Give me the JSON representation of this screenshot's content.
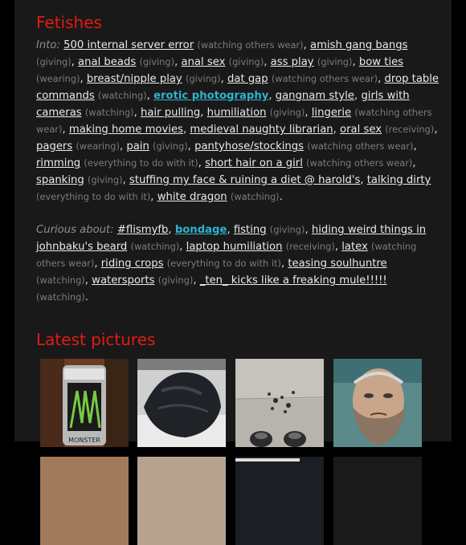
{
  "sections": {
    "fetishes_title": "Fetishes",
    "pictures_title": "Latest pictures"
  },
  "into": {
    "label": "Into:",
    "items": [
      {
        "name": "500 internal server error",
        "role": "(watching others wear)"
      },
      {
        "name": "amish gang bangs",
        "role": "(giving)"
      },
      {
        "name": "anal beads",
        "role": "(giving)"
      },
      {
        "name": "anal sex",
        "role": "(giving)"
      },
      {
        "name": "ass play",
        "role": "(giving)"
      },
      {
        "name": "bow ties",
        "role": "(wearing)"
      },
      {
        "name": "breast/nipple play",
        "role": "(giving)"
      },
      {
        "name": "dat gap",
        "role": "(watching others wear)"
      },
      {
        "name": "drop table commands",
        "role": "(watching)"
      },
      {
        "name": "erotic photography",
        "role": "",
        "highlight": true
      },
      {
        "name": "gangnam style",
        "role": ""
      },
      {
        "name": "girls with cameras",
        "role": "(watching)"
      },
      {
        "name": "hair pulling",
        "role": ""
      },
      {
        "name": "humiliation",
        "role": "(giving)"
      },
      {
        "name": "lingerie",
        "role": "(watching others wear)"
      },
      {
        "name": "making home movies",
        "role": ""
      },
      {
        "name": "medieval naughty librarian",
        "role": ""
      },
      {
        "name": "oral sex",
        "role": "(receiving)"
      },
      {
        "name": "pagers",
        "role": "(wearing)"
      },
      {
        "name": "pain",
        "role": "(giving)"
      },
      {
        "name": "pantyhose/stockings",
        "role": "(watching others wear)"
      },
      {
        "name": "rimming",
        "role": "(everything to do with it)"
      },
      {
        "name": "short hair on a girl",
        "role": "(watching others wear)"
      },
      {
        "name": "spanking",
        "role": "(giving)"
      },
      {
        "name": "stuffing my face & ruining a diet @ harold's",
        "role": ""
      },
      {
        "name": "talking dirty",
        "role": "(everything to do with it)"
      },
      {
        "name": "white dragon",
        "role": "(watching)"
      }
    ]
  },
  "curious": {
    "label": "Curious about:",
    "items": [
      {
        "name": "#flismyfb",
        "role": ""
      },
      {
        "name": "bondage",
        "role": "",
        "highlight": true
      },
      {
        "name": "fisting",
        "role": "(giving)"
      },
      {
        "name": "hiding weird things in johnbaku's beard",
        "role": "(watching)"
      },
      {
        "name": "laptop humiliation",
        "role": "(receiving)"
      },
      {
        "name": "latex",
        "role": "(watching others wear)"
      },
      {
        "name": "riding crops",
        "role": "(everything to do with it)"
      },
      {
        "name": "teasing soulhuntre",
        "role": "(watching)"
      },
      {
        "name": "watersports",
        "role": "(giving)"
      },
      {
        "name": "_ten_ kicks like a freaking mule!!!!!",
        "role": "(watching)"
      }
    ]
  },
  "pictures": {
    "thumbs": [
      {
        "icon": "energy-drink-can-photo",
        "caption_on_can": "MONSTER"
      },
      {
        "icon": "dark-clothing-photo"
      },
      {
        "icon": "floor-feet-photo"
      },
      {
        "icon": "bearded-man-portrait-photo"
      }
    ]
  },
  "colors": {
    "accent_title": "#e01c12",
    "highlight_link": "#2fb3cf",
    "panel_bg": "#191919",
    "page_bg": "#000000"
  }
}
